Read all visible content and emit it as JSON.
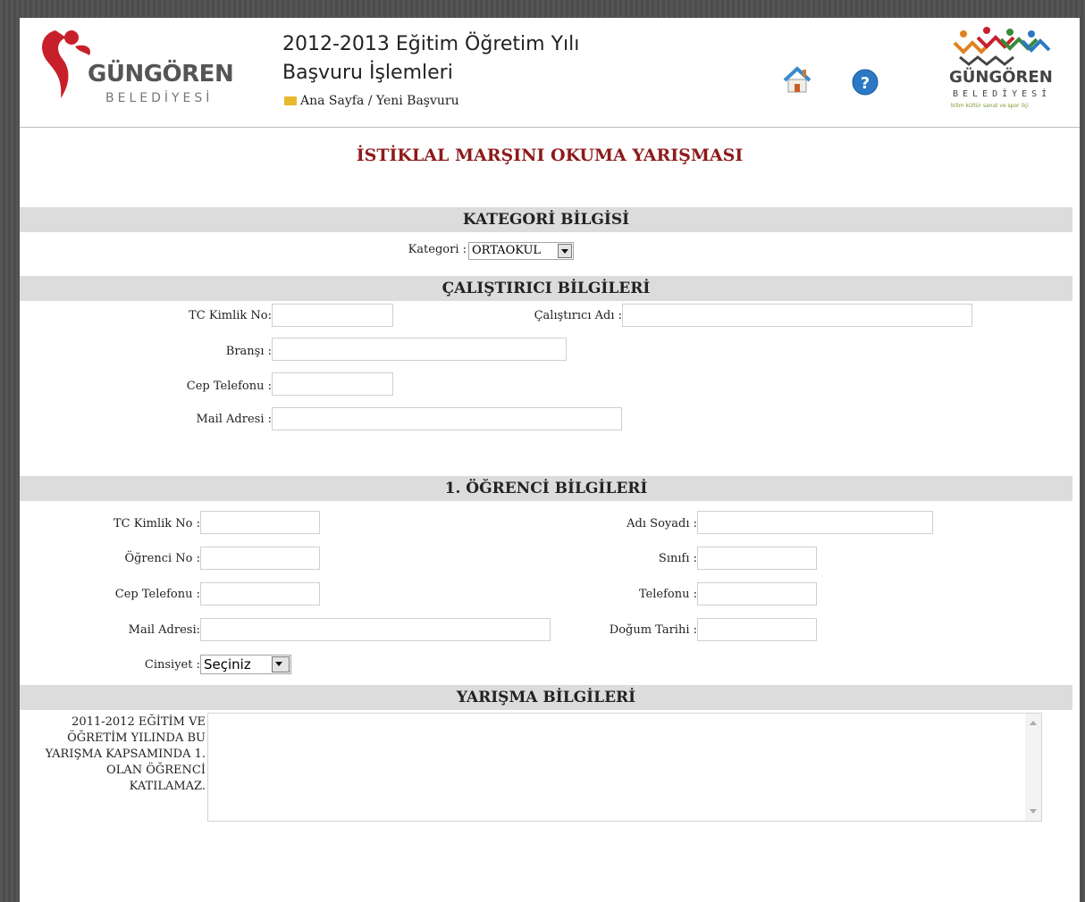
{
  "header": {
    "logo_left": {
      "brand": "GÜNGÖREN",
      "sub": "BELEDİYESİ"
    },
    "title_line1": "2012-2013 Eğitim Öğretim Yılı",
    "title_line2": "Başvuru İşlemleri",
    "breadcrumb": "Ana Sayfa / Yeni Başvuru",
    "icons": [
      "home-icon",
      "help-icon"
    ],
    "logo_right": {
      "brand": "GÜNGÖREN",
      "sub": "BELEDİYESİ",
      "tagline": "bilim kültür sanat ve spor ilçi"
    }
  },
  "page_title": "İSTİKLAL MARŞINI OKUMA YARIŞMASI",
  "kategori": {
    "section": "KATEGORİ BİLGİSİ",
    "label": "Kategori :",
    "value": "ORTAOKUL"
  },
  "calistirici": {
    "section": "ÇALIŞTIRICI BİLGİLERİ",
    "tc_label": "TC Kimlik No:",
    "name_label": "Çalıştırıcı Adı :",
    "brans_label": "Branşı :",
    "phone_label": "Cep Telefonu :",
    "mail_label": "Mail Adresi :"
  },
  "ogrenci": {
    "section": "1. ÖĞRENCİ BİLGİLERİ",
    "tc_label": "TC Kimlik No :",
    "name_label": "Adı Soyadı :",
    "no_label": "Öğrenci No :",
    "class_label": "Sınıfı :",
    "cell_label": "Cep Telefonu :",
    "phone_label": "Telefonu :",
    "mail_label": "Mail Adresi:",
    "birth_label": "Doğum Tarihi :",
    "gender_label": "Cinsiyet :",
    "gender_value": "Seçiniz"
  },
  "yarisma": {
    "section": "YARIŞMA BİLGİLERİ",
    "note_lines": [
      "2011-2012 EĞİTİM VE",
      "ÖĞRETİM YILINDA BU",
      "YARIŞMA KAPSAMINDA 1.",
      "OLAN ÖĞRENCİ",
      "KATILAMAZ."
    ]
  },
  "colors": {
    "title": "#8e1a1a",
    "section_bg": "#dcdcdc",
    "brand_red": "#c8202a"
  }
}
